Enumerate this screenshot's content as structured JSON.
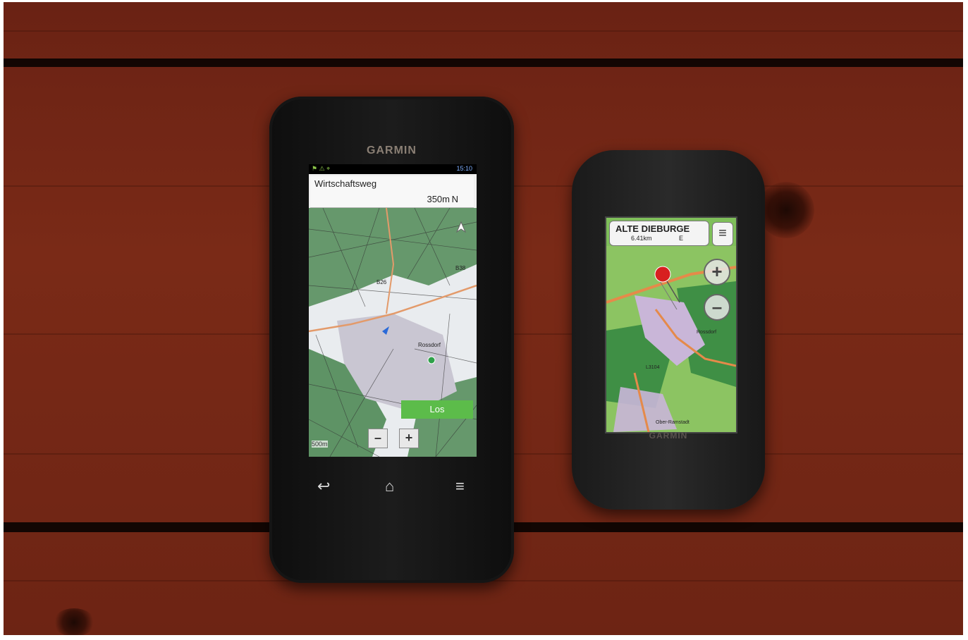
{
  "photo": {
    "description_hidden": ""
  },
  "device_left": {
    "brand": "GARMIN",
    "status_time": "15:10",
    "street": "Wirtschaftsweg",
    "distance": "350m",
    "heading": "N",
    "button_go": "Los",
    "zoom_out": "–",
    "zoom_in": "+",
    "scale": "500m",
    "map_labels": {
      "road1": "B26",
      "road2": "B38",
      "town": "Rossdorf"
    }
  },
  "device_right": {
    "brand": "GARMIN",
    "street": "ALTE DIEBURGE",
    "distance": "6.41km",
    "heading": "E",
    "zoom_in": "+",
    "zoom_out": "–",
    "map_labels": {
      "road": "L3104",
      "town": "Rossdorf",
      "place": "Ober-Ramstadt"
    }
  },
  "colors": {
    "wood": "#7a2a17",
    "map_green": "#5c8a55",
    "go_button": "#5cbc4a"
  }
}
